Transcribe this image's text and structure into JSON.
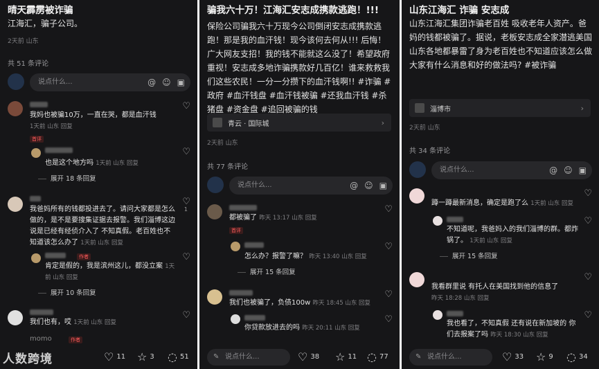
{
  "panels": [
    {
      "title": "晴天霹雳被诈骗",
      "body": "江海汇，骗子公司。",
      "meta": "2天前 山东",
      "comment_count": "共 51 条评论",
      "input_placeholder": "说点什么...",
      "comments": [
        {
          "text": "我妈也被骗10万，一直在哭，都是血汗钱",
          "time": "1天前 山东 回复",
          "badge": "首评"
        },
        {
          "text": "也是这个地方吗",
          "time": "1天前 山东 回复"
        },
        {
          "expand": "展开 18 条回复"
        },
        {
          "text": "我爸妈所有的钱都投进去了。请问大家都是怎么做的，是不是要搜集证据去报警。我们淄博这边说是已经有经侦介入了 不知真假。老百姓也不知道该怎么办了",
          "time": "1天前 山东 回复",
          "likes": "1"
        },
        {
          "text": "肯定是假的，我是滨州这儿，都没立案",
          "time": "1天前 山东 回复",
          "badge": "作者"
        },
        {
          "expand": "展开 10 条回复"
        },
        {
          "text": "我们也有，哎",
          "time": "1天前 山东 回复"
        },
        {
          "text": "momo",
          "badge": "作者"
        }
      ],
      "stats": {
        "likes": "11",
        "stars": "3",
        "comments": "51"
      }
    },
    {
      "title": "骗我六十万！江海汇安志成携款逃跑！!!!",
      "body": "保险公司骗我六十万现今公司倒闭安志成携款逃跑！那是我的血汗钱！现今该何去何从!!! 后悔！广大网友支招！我的钱不能就这么没了！希望政府重视！安志成多地诈骗携款好几百亿！谁来救救我们这些农民！一分一分攒下的血汗钱啊!! #诈骗 #政府 #血汗钱盘 #血汗钱被骗 #还我血汗钱 #杀猪盘 #资金盘 #追回被骗的钱",
      "location": "青云 · 国际城",
      "meta": "2天前 山东",
      "comment_count": "共 77 条评论",
      "input_placeholder": "说点什么...",
      "comments": [
        {
          "text": "都被骗了",
          "time": "昨天 13:17 山东 回复",
          "badge": "首评"
        },
        {
          "text": "怎么办？报警了嘛？",
          "time": "昨天 13:40 山东 回复"
        },
        {
          "expand": "展开 15 条回复"
        },
        {
          "text": "我们也被骗了，负债100w",
          "time": "昨天 18:45 山东 回复"
        },
        {
          "text": "你贷款放进去的吗",
          "time": "昨天 20:11 山东 回复"
        }
      ],
      "stats": {
        "likes": "38",
        "stars": "11",
        "comments": "77"
      }
    },
    {
      "title": "山东江海汇 诈骗 安志成",
      "body": "山东江海汇集团诈骗老百姓 吸收老年人资产。爸妈的钱都被骗了。据说，老板安志成全家潜逃美国山东各地都暴雷了身为老百姓也不知道应该怎么做大家有什么消息和好的做法吗? #被诈骗",
      "location": "淄博市",
      "meta": "2天前 山东",
      "comment_count": "共 34 条评论",
      "input_placeholder": "说点什么...",
      "comments": [
        {
          "text": "蹲一蹲最新消息，确定是跑了么",
          "time": "1天前 山东 回复"
        },
        {
          "text": "不知道呢，我爸妈入的我们淄博的群。都炸锅了。",
          "time": "1天前 山东 回复"
        },
        {
          "expand": "展开 15 条回复"
        },
        {
          "text": "我看群里说 有托人在美国找到他的信息了",
          "time": "昨天 18:28 山东 回复"
        },
        {
          "text": "我也看了，不知真假 还有说在新加坡的 你们去报案了吗",
          "time": "昨天 18:30 山东 回复"
        }
      ],
      "stats": {
        "likes": "33",
        "stars": "9",
        "comments": "34"
      }
    }
  ],
  "watermark": "人数跨境",
  "icons": [
    "at-icon",
    "emoji-icon",
    "image-icon",
    "heart-icon",
    "star-icon",
    "comment-icon",
    "pencil-icon",
    "chevron-right-icon",
    "location-icon"
  ],
  "colors": {
    "background": "#161618",
    "badge": "#ff5a5a",
    "text": "#e6e6e6"
  }
}
